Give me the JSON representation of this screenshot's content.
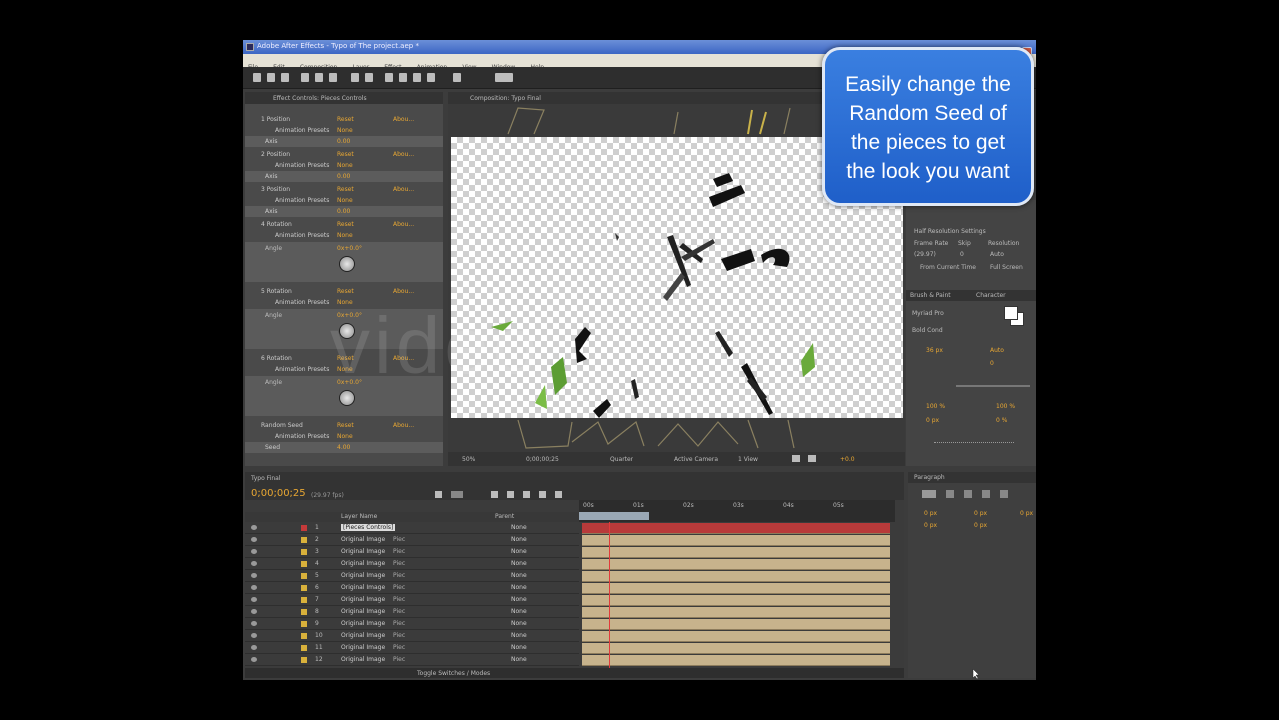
{
  "window": {
    "title": "Adobe After Effects - Typo of The project.aep *"
  },
  "menu": [
    "File",
    "Edit",
    "Composition",
    "Layer",
    "Effect",
    "Animation",
    "View",
    "Window",
    "Help"
  ],
  "effect_controls": {
    "header": "Effect Controls: Pieces Controls",
    "rows": [
      {
        "label": "1 Position",
        "value": "Reset",
        "value2": "Abou..."
      },
      {
        "label": "Animation Presets",
        "value": "None"
      },
      {
        "label": "Axis",
        "value": "0.00"
      },
      {
        "label": "2 Position",
        "value": "Reset",
        "value2": "Abou..."
      },
      {
        "label": "Animation Presets",
        "value": "None"
      },
      {
        "label": "Axis",
        "value": "0.00"
      },
      {
        "label": "3 Position",
        "value": "Reset",
        "value2": "Abou..."
      },
      {
        "label": "Animation Presets",
        "value": "None"
      },
      {
        "label": "Axis",
        "value": "0.00"
      },
      {
        "label": "4 Rotation",
        "value": "Reset",
        "value2": "Abou..."
      },
      {
        "label": "Animation Presets",
        "value": "None"
      },
      {
        "label": "Angle",
        "value": "0x+0.0°"
      },
      {
        "label": "5 Rotation",
        "value": "Reset",
        "value2": "Abou..."
      },
      {
        "label": "Animation Presets",
        "value": "None"
      },
      {
        "label": "Angle",
        "value": "0x+0.0°"
      },
      {
        "label": "6 Rotation",
        "value": "Reset",
        "value2": "Abou..."
      },
      {
        "label": "Animation Presets",
        "value": "None"
      },
      {
        "label": "Angle",
        "value": "0x+0.0°"
      },
      {
        "label": "Random Seed",
        "value": "Reset",
        "value2": "Abou..."
      },
      {
        "label": "Animation Presets",
        "value": "None"
      },
      {
        "label": "Seed",
        "value": "4.00"
      }
    ]
  },
  "composition": {
    "tab": "Composition: Typo Final",
    "zoom": "50%",
    "timecode": "0;00;00;25",
    "quality": "Quarter",
    "view": "Active Camera",
    "views": "1 View",
    "exposure": "+0.0"
  },
  "info_panel": {
    "preset": "Half Resolution Settings",
    "frame_rate_label": "Frame Rate",
    "skip_label": "Skip",
    "resolution_label": "Resolution",
    "frame_rate": "(29.97)",
    "skip": "0",
    "resolution": "Auto",
    "from_current_time": "From Current Time",
    "full_screen": "Full Screen"
  },
  "character_panel": {
    "tabs": [
      "Brush & Paint",
      "Character"
    ],
    "font": "Myriad Pro",
    "style": "Bold Cond",
    "size": "36 px",
    "leading": "Auto",
    "tracking": "0",
    "scale_v": "100 %",
    "scale_h": "100 %",
    "baseline": "0 px",
    "tsume": "0 %"
  },
  "timeline": {
    "tab": "Typo Final",
    "timecode": "0;00;00;25",
    "fps": "(29.97 fps)",
    "columns": {
      "layer_name": "Layer Name",
      "parent": "Parent"
    },
    "ruler_marks": [
      "00s",
      "01s",
      "02s",
      "03s",
      "04s",
      "05s"
    ],
    "layers": [
      {
        "num": "1",
        "name": "[Pieces Controls]",
        "tag": "",
        "parent": "None",
        "color": "red"
      },
      {
        "num": "2",
        "name": "Original Image",
        "tag": "Piec",
        "parent": "None"
      },
      {
        "num": "3",
        "name": "Original Image",
        "tag": "Piec",
        "parent": "None"
      },
      {
        "num": "4",
        "name": "Original Image",
        "tag": "Piec",
        "parent": "None"
      },
      {
        "num": "5",
        "name": "Original Image",
        "tag": "Piec",
        "parent": "None"
      },
      {
        "num": "6",
        "name": "Original Image",
        "tag": "Piec",
        "parent": "None"
      },
      {
        "num": "7",
        "name": "Original Image",
        "tag": "Piec",
        "parent": "None"
      },
      {
        "num": "8",
        "name": "Original Image",
        "tag": "Piec",
        "parent": "None"
      },
      {
        "num": "9",
        "name": "Original Image",
        "tag": "Piec",
        "parent": "None"
      },
      {
        "num": "10",
        "name": "Original Image",
        "tag": "Piec",
        "parent": "None"
      },
      {
        "num": "11",
        "name": "Original Image",
        "tag": "Piec",
        "parent": "None"
      },
      {
        "num": "12",
        "name": "Original Image",
        "tag": "Piec",
        "parent": "None"
      }
    ],
    "footer": "Toggle Switches / Modes"
  },
  "tracker_panel": {
    "tab": "Paragraph",
    "values": [
      "0 px",
      "0 px",
      "0 px",
      "0 px",
      "0 px"
    ]
  },
  "callout": {
    "line1": "Easily change the",
    "line2": "Random Seed of",
    "line3": "the pieces to get",
    "line4": "the look you want"
  },
  "watermark": "video"
}
